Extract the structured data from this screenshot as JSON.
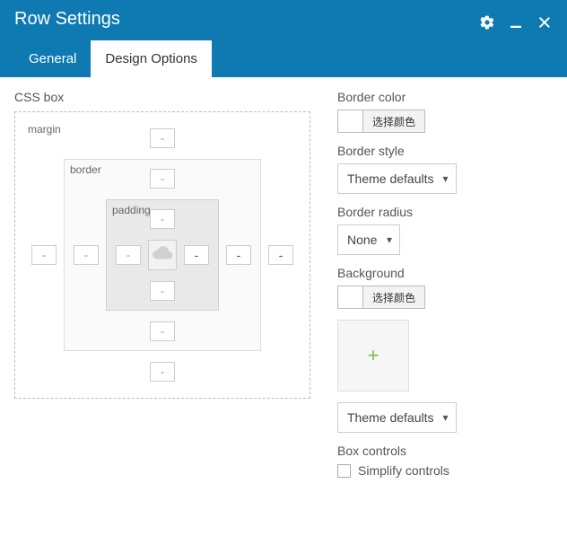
{
  "header": {
    "title": "Row Settings"
  },
  "tabs": {
    "general": "General",
    "design": "Design Options"
  },
  "css_box": {
    "title": "CSS box",
    "margin_label": "margin",
    "border_label": "border",
    "padding_label": "padding",
    "dash": "-"
  },
  "right": {
    "border_color_label": "Border color",
    "border_style_label": "Border style",
    "border_style_value": "Theme defaults",
    "border_radius_label": "Border radius",
    "border_radius_value": "None",
    "background_label": "Background",
    "bg_select_value": "Theme defaults",
    "color_btn": "选择颜色",
    "add_image": "+",
    "box_controls_label": "Box controls",
    "simplify_label": "Simplify controls"
  }
}
